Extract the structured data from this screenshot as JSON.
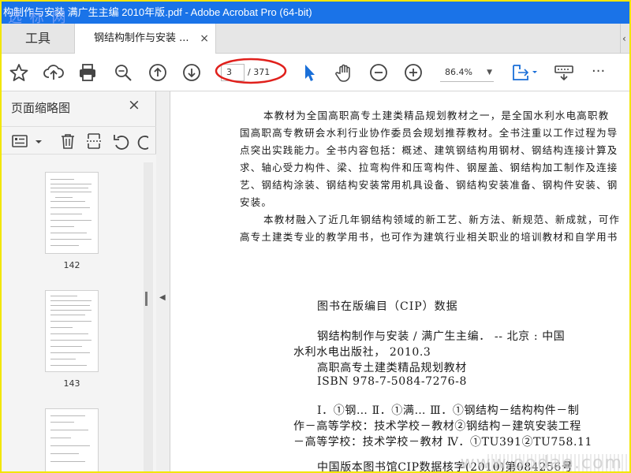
{
  "window": {
    "title": "构制作与安装 满广生主编 2010年版.pdf - Adobe Acrobat Pro (64-bit)",
    "watermark_top": "选 标 网"
  },
  "tabs": {
    "tools_label": "工具",
    "doc_label": "钢结构制作与安装 ...",
    "close": "×",
    "more": "‹"
  },
  "toolbar": {
    "page_current": "3",
    "page_total": "/ 371",
    "zoom": "86.4%",
    "zoom_arrow": "▼",
    "more": "···",
    "icons": [
      "star-icon",
      "cloud-upload-icon",
      "print-icon",
      "zoom-search-icon",
      "page-up-icon",
      "page-down-icon",
      "select-cursor-icon",
      "hand-icon",
      "zoom-out-icon",
      "zoom-in-icon",
      "fit-page-icon",
      "keyboard-icon",
      "more-icon"
    ],
    "accent": "#1a73e8",
    "highlight": "#e0201c"
  },
  "sidebar": {
    "title": "页面缩略图",
    "close": "×",
    "thumbnails": [
      {
        "label": "142"
      },
      {
        "label": "143"
      },
      {
        "label": ""
      }
    ]
  },
  "document": {
    "paragraph_lines": [
      "本教材为全国高职高专土建类精品规划教材之一，是全国水利水电高职教",
      "国高职高专教研会水利行业协作委员会规划推荐教材。全书注重以工作过程为导",
      "点突出实践能力。全书内容包括：概述、建筑钢结构用钢材、钢结构连接计算及",
      "求、轴心受力构件、梁、拉弯构件和压弯构件、钢屋盖、钢结构加工制作及连接",
      "艺、钢结构涂装、钢结构安装常用机具设备、钢结构安装准备、钢构件安装、钢",
      "安装。",
      "本教材融入了近几年钢结构领域的新工艺、新方法、新规范、新成就，可作",
      "高专土建类专业的教学用书，也可作为建筑行业相关职业的培训教材和自学用书"
    ],
    "cip_title": "图书在版编目（CIP）数据",
    "cip_lines": [
      "钢结构制作与安装 / 满广生主编． -- 北京 : 中国",
      "水利水电出版社， 2010.3",
      "高职高专土建类精品规划教材",
      "ISBN 978-7-5084-7276-8",
      "Ⅰ．①钢…  Ⅱ．①满…  Ⅲ．①钢结构－结构构件－制",
      "作－高等学校：技术学校－教材②钢结构－建筑安装工程",
      "－高等学校：技术学校－教材  Ⅳ．①TU391②TU758.11",
      "中国版本图书馆CIP数据核字(2010)第084256号"
    ],
    "watermark_bottom": "www.oodao.com"
  }
}
